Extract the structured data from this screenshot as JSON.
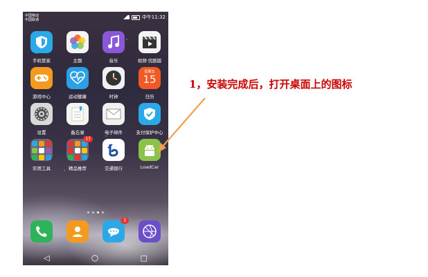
{
  "status_bar": {
    "carrier_1": "中国移动",
    "carrier_2": "中国联通",
    "time": "中午11:32"
  },
  "apps": [
    {
      "label": "手机管家",
      "icon": "shield-icon",
      "color": "#2aa8e8"
    },
    {
      "label": "主题",
      "icon": "flower-icon",
      "color": "#f4f4f4"
    },
    {
      "label": "音乐",
      "icon": "music-note-icon",
      "color": "#8a57d9"
    },
    {
      "label": "视频·优酷版",
      "icon": "clapperboard-icon",
      "color": "#f4f4f4"
    },
    {
      "label": "游戏中心",
      "icon": "gamepad-icon",
      "color": "#f39a1f"
    },
    {
      "label": "运动健康",
      "icon": "heart-pulse-icon",
      "color": "#2aa0e6"
    },
    {
      "label": "时钟",
      "icon": "clock-icon",
      "color": "#f0f0f0"
    },
    {
      "label": "日历",
      "icon": "calendar-icon",
      "color": "#f15a24",
      "day_name": "星期五",
      "day_number": "15"
    },
    {
      "label": "设置",
      "icon": "gear-icon",
      "color": "#d9d9d9"
    },
    {
      "label": "备忘录",
      "icon": "notepad-icon",
      "color": "#f5f5f0"
    },
    {
      "label": "电子邮件",
      "icon": "envelope-icon",
      "color": "#f0f0f0"
    },
    {
      "label": "支付保护中心",
      "icon": "shield-check-icon",
      "color": "#2aa8e8"
    },
    {
      "label": "实用工具",
      "icon": "folder-icon",
      "color": "#8a8090"
    },
    {
      "label": "精品推荐",
      "icon": "folder-icon",
      "color": "#8a8090",
      "badge": "17"
    },
    {
      "label": "交通银行",
      "icon": "bank-logo-icon",
      "color": "#ffffff"
    },
    {
      "label": "LoadCar",
      "icon": "android-icon",
      "color": "#8bc34a"
    }
  ],
  "dock": [
    {
      "icon": "phone-icon",
      "color": "#2fb35a"
    },
    {
      "icon": "contacts-icon",
      "color": "#f39a1f"
    },
    {
      "icon": "message-icon",
      "color": "#2aa8e8",
      "badge": "3"
    },
    {
      "icon": "browser-icon",
      "color": "#6a4fc9"
    }
  ],
  "nav": {
    "back": "◁",
    "home": "○",
    "recent": "□"
  },
  "annotation": {
    "text": "1，安装完成后，打开桌面上的图标",
    "color": "#cc0000",
    "arrow_color": "#f0a050"
  }
}
